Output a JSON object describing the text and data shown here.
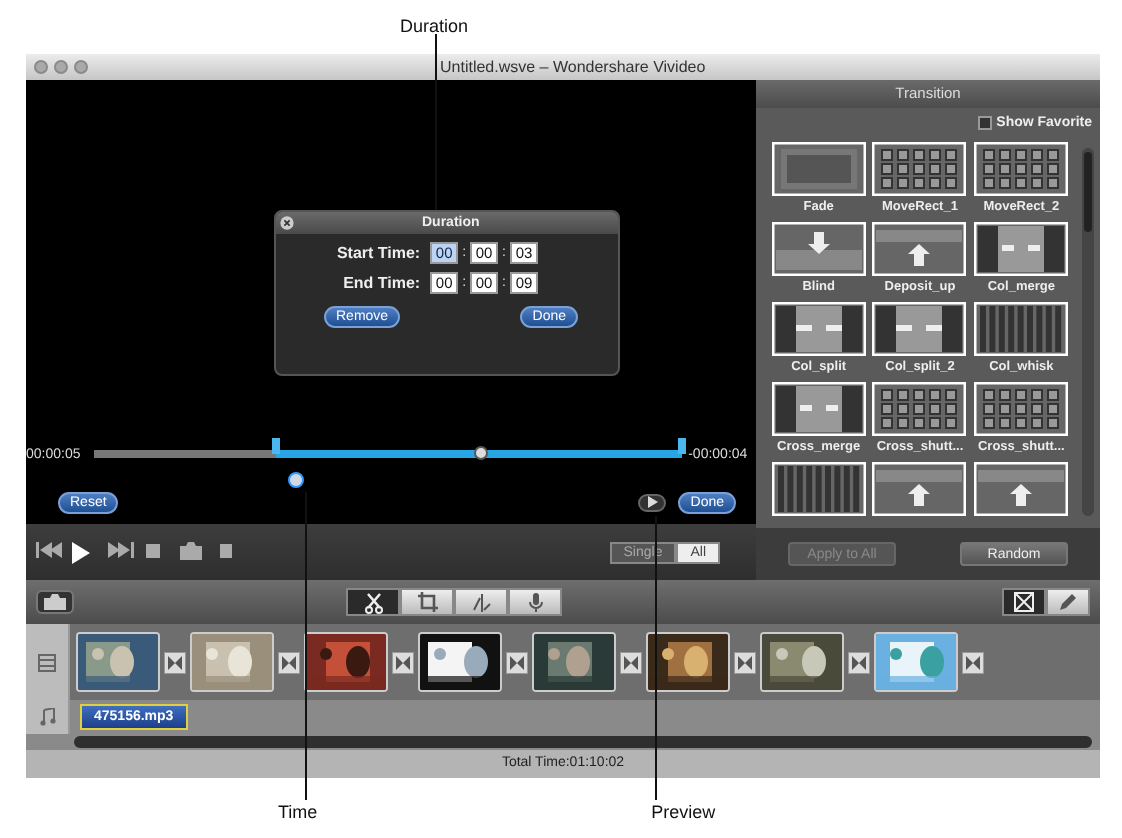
{
  "annotations": [
    {
      "label": "Duration"
    },
    {
      "label": "Time"
    },
    {
      "label": "Preview"
    }
  ],
  "window": {
    "title": "Untitled.wsve – Wondershare Vivideo"
  },
  "player": {
    "elapsed": "00:00:05",
    "remaining": "-00:00:04",
    "trim": {
      "level": 0.31
    },
    "reset_button": "Reset",
    "done_button": "Done",
    "view_modes": [
      {
        "label": "Single",
        "selected": false
      },
      {
        "label": "All",
        "selected": true
      }
    ]
  },
  "dialog": {
    "title": "Duration",
    "rows": [
      {
        "label": "Start Time:",
        "fields": [
          {
            "value": "00",
            "selected": true
          },
          {
            "value": "00",
            "selected": false
          },
          {
            "value": "03",
            "selected": false
          }
        ]
      },
      {
        "label": "End Time:",
        "fields": [
          {
            "value": "00",
            "selected": false
          },
          {
            "value": "00",
            "selected": false
          },
          {
            "value": "09",
            "selected": false
          }
        ]
      }
    ],
    "separator": ":",
    "remove_button": "Remove",
    "done_button": "Done"
  },
  "transition_panel": {
    "title": "Transition",
    "show_favorite": {
      "label": "Show Favorite",
      "checked": false
    },
    "items": [
      {
        "label": "Fade",
        "kind": "fade"
      },
      {
        "label": "MoveRect_1",
        "kind": "grid"
      },
      {
        "label": "MoveRect_2",
        "kind": "grid"
      },
      {
        "label": "Blind",
        "kind": "down"
      },
      {
        "label": "Deposit_up",
        "kind": "up"
      },
      {
        "label": "Col_merge",
        "kind": "merge"
      },
      {
        "label": "Col_split",
        "kind": "split"
      },
      {
        "label": "Col_split_2",
        "kind": "split"
      },
      {
        "label": "Col_whisk",
        "kind": "bars"
      },
      {
        "label": "Cross_merge",
        "kind": "merge"
      },
      {
        "label": "Cross_shutt...",
        "kind": "grid"
      },
      {
        "label": "Cross_shutt...",
        "kind": "grid"
      },
      {
        "kind": "bars"
      },
      {
        "kind": "up"
      },
      {
        "kind": "up"
      }
    ],
    "apply_all_button": {
      "label": "Apply to All",
      "disabled": true
    },
    "random_button": "Random"
  },
  "toolbar": {
    "tools": [
      {
        "kind": "scissors",
        "selected": true
      },
      {
        "kind": "crop",
        "selected": false
      },
      {
        "kind": "effect",
        "selected": false
      },
      {
        "kind": "mic",
        "selected": false
      }
    ],
    "views": [
      {
        "kind": "transition",
        "selected": true
      },
      {
        "kind": "pencil",
        "selected": false
      }
    ]
  },
  "timeline": {
    "audio": {
      "name": "475156.mp3",
      "selected": true
    }
  },
  "status_bar": "Total Time:01:10:02"
}
